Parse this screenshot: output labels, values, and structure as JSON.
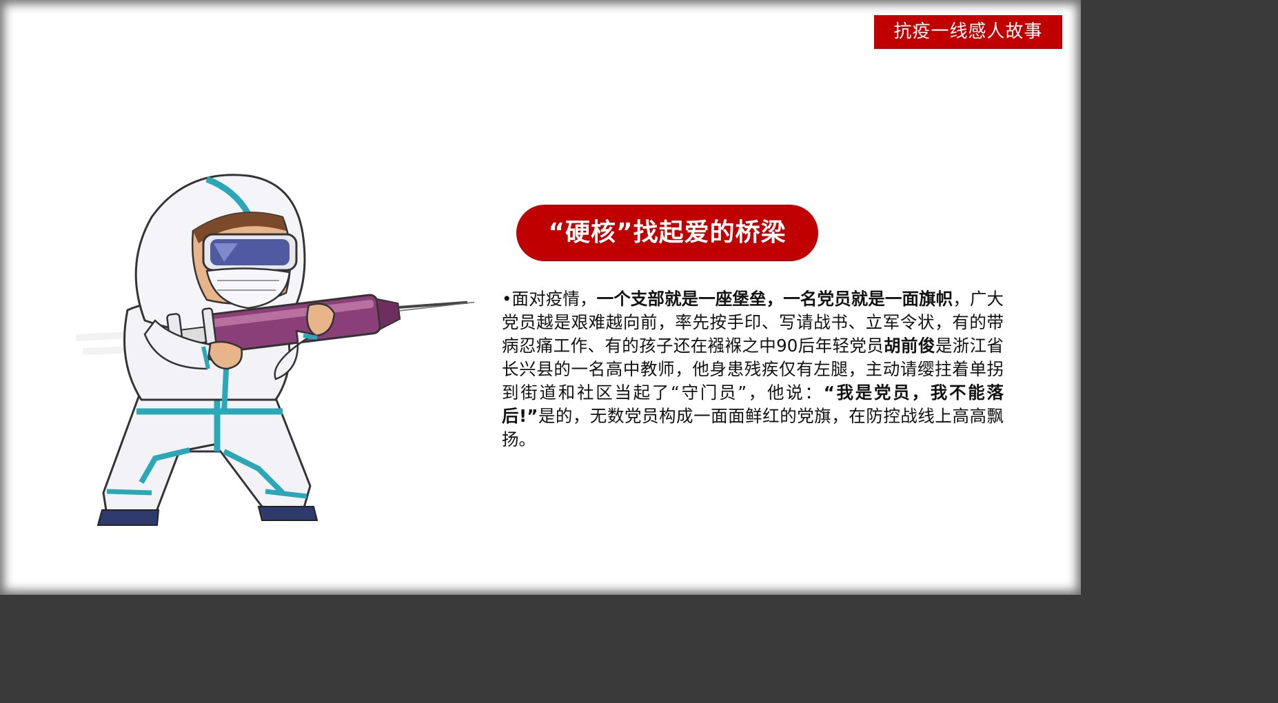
{
  "tag": {
    "label": "抗疫一线感人故事"
  },
  "headline": {
    "text": "“硬核”找起爱的桥梁"
  },
  "body": {
    "bullet": "•",
    "p1": "面对疫情，",
    "b1": "一个支部就是一座堡垒，一名党员就是一面旗帜",
    "p2": "，广大党员越是艰难越向前，率先按手印、写请战书、立军令状，有的带病忍痛工作、有的孩子还在襁褓之中90后年轻党员",
    "b2": "胡前俊",
    "p3": "是浙江省长兴县的一名高中教师，他身患残疾仅有左腿，主动请缨拄着单拐到街道和社区当起了“守门员”，他说：",
    "b3": "“我是党员，我不能落后!”",
    "p4": "是的，无数党员构成一面面鲜红的党旗，在防控战线上高高飘扬。"
  },
  "colors": {
    "accent_red": "#c00000",
    "suit_teal": "#2aa8b8",
    "syringe_purple": "#8a3f78"
  },
  "illustration": {
    "icon": "medical-worker-syringe-icon"
  }
}
